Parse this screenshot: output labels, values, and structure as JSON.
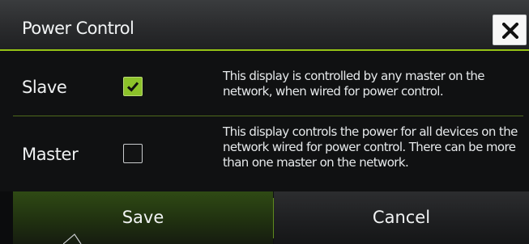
{
  "dialog": {
    "title": "Power Control",
    "close_icon": "close-icon",
    "accent_color": "#95c316"
  },
  "options": [
    {
      "label": "Slave",
      "checked": true,
      "description": "This display is controlled by any master on the network, when wired for power control."
    },
    {
      "label": "Master",
      "checked": false,
      "description": "This display controls the power for all devices on the network wired for power control. There can be more than one master on the network."
    }
  ],
  "buttons": {
    "save_label": "Save",
    "cancel_label": "Cancel"
  }
}
